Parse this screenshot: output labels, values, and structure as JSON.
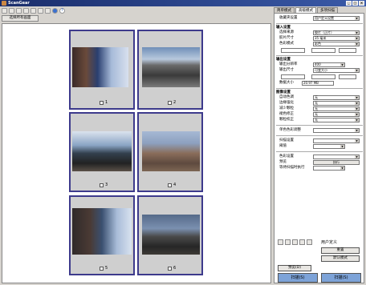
{
  "window": {
    "title": "ScanGear"
  },
  "toolbar": {
    "select_all_label": "选择所有画面"
  },
  "thumbnails": [
    {
      "number": "1"
    },
    {
      "number": "2"
    },
    {
      "number": "3"
    },
    {
      "number": "4"
    },
    {
      "number": "5"
    },
    {
      "number": "6"
    }
  ],
  "right_panel": {
    "tabs": [
      "简单模式",
      "高级模式",
      "多项扫描"
    ],
    "favorite_label": "收藏夹设置",
    "favorite_value": "用户定义设置",
    "input_section": "输入设置",
    "input_rows": [
      {
        "label": "选择来源",
        "value": "胶片（正片）"
      },
      {
        "label": "胶片尺寸",
        "value": "35 毫米"
      },
      {
        "label": "色彩模式",
        "value": "彩色"
      }
    ],
    "output_section": "输出设置",
    "output_rows": [
      {
        "label": "输出分辨率",
        "value": "400"
      },
      {
        "label": "输出尺寸",
        "value": "可变大小"
      }
    ],
    "data_size_label": "数据大小",
    "data_size_value": "20.97 MB",
    "image_section": "图像设置",
    "image_rows": [
      {
        "label": "自动色调",
        "value": "无"
      },
      {
        "label": "边缘强化",
        "value": "无"
      },
      {
        "label": "减少颗粒",
        "value": "无"
      },
      {
        "label": "褪色修正",
        "value": "无"
      },
      {
        "label": "颗粒校正",
        "value": "无"
      }
    ],
    "mid_rows": [
      {
        "label": "单色色彩调整",
        "value": ""
      },
      {
        "label": "扫描设置",
        "value": ""
      },
      {
        "label": "阈值",
        "value": ""
      },
      {
        "label": "色彩设置",
        "value": ""
      },
      {
        "label": "预览",
        "value": "执行"
      },
      {
        "label": "等待扫描时执行",
        "value": ""
      }
    ],
    "preset_value": "用户定义",
    "reset_label": "重置",
    "save_label": "保存",
    "default_label": "默认模式",
    "preview_button": "预览(D)",
    "zoom_button": "扫描(S)",
    "scan_button": "扫描(S)"
  }
}
